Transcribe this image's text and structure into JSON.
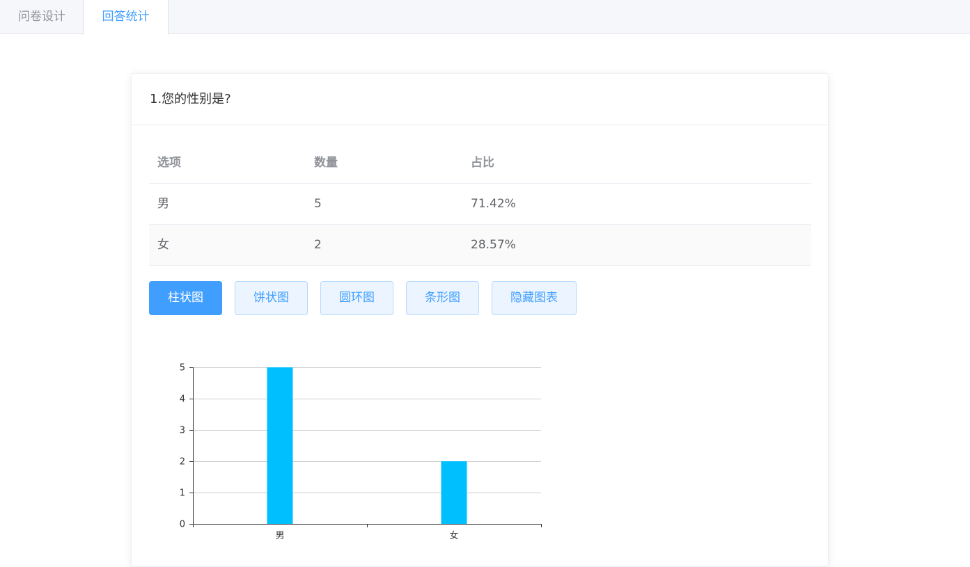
{
  "tabs": [
    {
      "label": "问卷设计",
      "active": false
    },
    {
      "label": "回答统计",
      "active": true
    }
  ],
  "question": {
    "title": "1.您的性别是?"
  },
  "table": {
    "headers": [
      "选项",
      "数量",
      "占比"
    ],
    "rows": [
      {
        "option": "男",
        "count": "5",
        "percent": "71.42%"
      },
      {
        "option": "女",
        "count": "2",
        "percent": "28.57%"
      }
    ]
  },
  "chart_buttons": {
    "bar": "柱状图",
    "pie": "饼状图",
    "ring": "圆环图",
    "hbar": "条形图",
    "hide": "隐藏图表"
  },
  "colors": {
    "accent": "#409eff",
    "bar": "#00bfff"
  },
  "chart_data": {
    "type": "bar",
    "categories": [
      "男",
      "女"
    ],
    "values": [
      5,
      2
    ],
    "ylim": [
      0,
      5
    ],
    "yticks": [
      0,
      1,
      2,
      3,
      4,
      5
    ],
    "grid": true,
    "title": "",
    "xlabel": "",
    "ylabel": ""
  }
}
